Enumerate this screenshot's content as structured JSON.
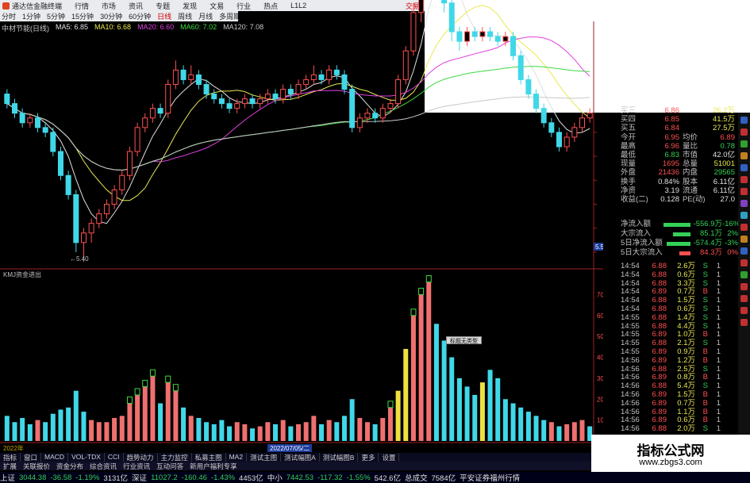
{
  "menu": [
    "通达信金融终端",
    "行情",
    "市场",
    "资讯",
    "专题",
    "发现",
    "文易",
    "行业",
    "热点",
    "L1L2"
  ],
  "trade_label": "交易",
  "periods": [
    "分时",
    "1分钟",
    "5分钟",
    "15分钟",
    "30分钟",
    "60分钟",
    "日线",
    "周线",
    "月线",
    "多周期",
    "更多"
  ],
  "active_period": "日线",
  "ma_legend": [
    {
      "text": "中材节能(日线)",
      "color": "#c8c8c8"
    },
    {
      "text": "MA5: 6.85",
      "color": "#e0e0e0"
    },
    {
      "text": "MA10: 6.68",
      "color": "#e8e850"
    },
    {
      "text": "MA20: 6.60",
      "color": "#e040e0"
    },
    {
      "text": "MA60: 7.02",
      "color": "#40d840"
    },
    {
      "text": "MA120: 7.08",
      "color": "#c8c8c8"
    }
  ],
  "price_axis": [
    "7.75",
    "7.50",
    "7.25",
    "7.00",
    "6.75",
    "6.50",
    "6.25",
    "6.00",
    "5.75",
    "5.50"
  ],
  "current_price_tag": "5.54",
  "low_marker": "5.40",
  "indicator_title": "KMJ资金进出",
  "vol_axis": [
    "70000",
    "60000",
    "50000",
    "40000",
    "30000",
    "20000",
    "10000"
  ],
  "x_label_year": "2022年",
  "x_label_date": "2022/07/05/二",
  "tooltip": "标题无类型",
  "quote": [
    {
      "l1": "买三",
      "v1": "6.86",
      "v1c": "red",
      "l2": "",
      "v2": "26.2万",
      "v2c": "yellow"
    },
    {
      "l1": "买四",
      "v1": "6.85",
      "v1c": "red",
      "l2": "",
      "v2": "41.5万",
      "v2c": "yellow"
    },
    {
      "l1": "买五",
      "v1": "6.84",
      "v1c": "red",
      "l2": "",
      "v2": "27.5万",
      "v2c": "yellow"
    },
    {
      "l1": "今开",
      "v1": "6.95",
      "v1c": "red",
      "l2": "均价",
      "v2": "6.89",
      "v2c": "red"
    },
    {
      "l1": "最高",
      "v1": "6.96",
      "v1c": "red",
      "l2": "量比",
      "v2": "0.78",
      "v2c": "green"
    },
    {
      "l1": "最低",
      "v1": "6.83",
      "v1c": "green",
      "l2": "市值",
      "v2": "42.0亿",
      "v2c": "white"
    },
    {
      "l1": "现量",
      "v1": "1695",
      "v1c": "red",
      "l2": "总量",
      "v2": "51001",
      "v2c": "yellow"
    },
    {
      "l1": "外盘",
      "v1": "21436",
      "v1c": "red",
      "l2": "内盘",
      "v2": "29565",
      "v2c": "green"
    },
    {
      "l1": "换手",
      "v1": "0.84%",
      "v1c": "white",
      "l2": "股本",
      "v2": "6.11亿",
      "v2c": "white"
    },
    {
      "l1": "净资",
      "v1": "3.19",
      "v1c": "white",
      "l2": "流通",
      "v2": "6.11亿",
      "v2c": "white"
    },
    {
      "l1": "收益(二)",
      "v1": "0.128",
      "v1c": "white",
      "l2": "PE(动)",
      "v2": "27.0",
      "v2c": "white"
    }
  ],
  "fund_flow": [
    {
      "name": "净流入额",
      "bar": 34,
      "bar_color": "#34d058",
      "value": "-556.9万",
      "value_color": "green",
      "pct": "-16%",
      "pct_color": "green"
    },
    {
      "name": "大宗流入",
      "bar": 22,
      "bar_color": "#34d058",
      "value": "85.1万",
      "value_color": "green",
      "pct": "2%",
      "pct_color": "green"
    },
    {
      "name": "5日净流入额",
      "bar": 30,
      "bar_color": "#34d058",
      "value": "-574.4万",
      "value_color": "green",
      "pct": "-3%",
      "pct_color": "green"
    },
    {
      "name": "5日大宗流入",
      "bar": 14,
      "bar_color": "#ff5050",
      "value": "84.3万",
      "value_color": "red",
      "pct": "0%",
      "pct_color": "red"
    }
  ],
  "ticks": [
    {
      "t": "14:54",
      "p": "6.88",
      "v": "2.6万",
      "bs": "S",
      "n": "1"
    },
    {
      "t": "14:54",
      "p": "6.88",
      "v": "0.6万",
      "bs": "S",
      "n": "1"
    },
    {
      "t": "14:54",
      "p": "6.88",
      "v": "3.3万",
      "bs": "S",
      "n": "1"
    },
    {
      "t": "14:54",
      "p": "6.89",
      "v": "0.7万",
      "bs": "B",
      "n": "1"
    },
    {
      "t": "14:54",
      "p": "6.88",
      "v": "1.5万",
      "bs": "S",
      "n": "1"
    },
    {
      "t": "14:54",
      "p": "6.88",
      "v": "0.6万",
      "bs": "S",
      "n": "1"
    },
    {
      "t": "14:55",
      "p": "6.88",
      "v": "1.4万",
      "bs": "S",
      "n": "1"
    },
    {
      "t": "14:55",
      "p": "6.88",
      "v": "4.4万",
      "bs": "S",
      "n": "1"
    },
    {
      "t": "14:55",
      "p": "6.89",
      "v": "1.0万",
      "bs": "B",
      "n": "1"
    },
    {
      "t": "14:55",
      "p": "6.88",
      "v": "2.1万",
      "bs": "S",
      "n": "1"
    },
    {
      "t": "14:55",
      "p": "6.89",
      "v": "0.9万",
      "bs": "B",
      "n": "1"
    },
    {
      "t": "14:56",
      "p": "6.89",
      "v": "1.2万",
      "bs": "B",
      "n": "1"
    },
    {
      "t": "14:56",
      "p": "6.88",
      "v": "2.5万",
      "bs": "S",
      "n": "1"
    },
    {
      "t": "14:56",
      "p": "6.89",
      "v": "0.8万",
      "bs": "B",
      "n": "1"
    },
    {
      "t": "14:56",
      "p": "6.88",
      "v": "5.4万",
      "bs": "S",
      "n": "1"
    },
    {
      "t": "14:56",
      "p": "6.89",
      "v": "1.5万",
      "bs": "B",
      "n": "1"
    },
    {
      "t": "14:56",
      "p": "6.89",
      "v": "0.7万",
      "bs": "B",
      "n": "1"
    },
    {
      "t": "14:56",
      "p": "6.89",
      "v": "1.1万",
      "bs": "B",
      "n": "1"
    },
    {
      "t": "14:56",
      "p": "6.89",
      "v": "0.6万",
      "bs": "B",
      "n": "1"
    },
    {
      "t": "14:56",
      "p": "6.88",
      "v": "2.0万",
      "bs": "S",
      "n": "1"
    }
  ],
  "func_tabs": [
    "指标",
    "窗口",
    "MACD",
    "VOL-TDX",
    "CCI",
    "趋势动力",
    "主力监控",
    "私募主图",
    "MA2",
    "测试主图",
    "测试幅图A",
    "测试幅图B",
    "更多",
    "设置"
  ],
  "func_tabs2": [
    "扩展",
    "关联报价",
    "资金分布",
    "综合资讯",
    "行业资讯",
    "互动问答",
    "新用户福利专享"
  ],
  "status": [
    {
      "text": "上证",
      "c": "white"
    },
    {
      "text": "3044.38",
      "c": "green"
    },
    {
      "text": "-36.58",
      "c": "green"
    },
    {
      "text": "-1.19%",
      "c": "green"
    },
    {
      "text": "3131亿",
      "c": "white"
    },
    {
      "text": "深证",
      "c": "white"
    },
    {
      "text": "11027.2",
      "c": "green"
    },
    {
      "text": "-160.46",
      "c": "green"
    },
    {
      "text": "-1.43%",
      "c": "green"
    },
    {
      "text": "4453亿",
      "c": "white"
    },
    {
      "text": "中小",
      "c": "white"
    },
    {
      "text": "7442.53",
      "c": "green"
    },
    {
      "text": "-117.32",
      "c": "green"
    },
    {
      "text": "-1.55%",
      "c": "green"
    },
    {
      "text": "542.6亿",
      "c": "white"
    },
    {
      "text": "总成交",
      "c": "white"
    },
    {
      "text": "7584亿",
      "c": "white"
    },
    {
      "text": "平安证券福州行情",
      "c": "white"
    }
  ],
  "watermark": {
    "title": "指标公式网",
    "url": "www.zbgs3.com"
  },
  "colors": {
    "up": "#ff5050",
    "down": "#40d8e8",
    "ma5": "#e0e0e0",
    "ma10": "#e8e850",
    "ma20": "#e040e0",
    "ma60": "#40d840",
    "ma120": "#c8c8c8",
    "axis": "#a02020"
  },
  "chart_data": {
    "type": "candlestick+bar",
    "price_ylim": [
      5.4,
      7.8
    ],
    "candles": [
      [
        7.15,
        7.05,
        7.2,
        7.0
      ],
      [
        7.05,
        6.95,
        7.1,
        6.9
      ],
      [
        6.95,
        6.85,
        7.0,
        6.8
      ],
      [
        6.85,
        6.9,
        6.95,
        6.8
      ],
      [
        6.9,
        6.8,
        6.95,
        6.75
      ],
      [
        6.8,
        6.75,
        6.85,
        6.7
      ],
      [
        6.75,
        6.55,
        6.8,
        6.5
      ],
      [
        6.55,
        6.3,
        6.6,
        6.25
      ],
      [
        6.3,
        6.1,
        6.35,
        6.05
      ],
      [
        6.1,
        5.6,
        6.15,
        5.5
      ],
      [
        5.6,
        5.7,
        5.75,
        5.4
      ],
      [
        5.7,
        5.8,
        5.85,
        5.6
      ],
      [
        5.8,
        5.9,
        5.95,
        5.75
      ],
      [
        5.9,
        6.0,
        6.05,
        5.85
      ],
      [
        6.0,
        6.15,
        6.2,
        5.95
      ],
      [
        6.15,
        6.3,
        6.35,
        6.1
      ],
      [
        6.3,
        6.55,
        6.6,
        6.25
      ],
      [
        6.55,
        6.8,
        6.85,
        6.5
      ],
      [
        6.8,
        6.9,
        6.95,
        6.75
      ],
      [
        6.9,
        7.0,
        7.05,
        6.85
      ],
      [
        7.0,
        6.95,
        7.05,
        6.9
      ],
      [
        6.95,
        7.25,
        7.3,
        6.9
      ],
      [
        7.25,
        7.4,
        7.5,
        7.2
      ],
      [
        7.4,
        7.3,
        7.45,
        7.25
      ],
      [
        7.3,
        7.35,
        7.45,
        7.25
      ],
      [
        7.35,
        7.25,
        7.4,
        7.2
      ],
      [
        7.25,
        7.15,
        7.3,
        7.1
      ],
      [
        7.15,
        7.1,
        7.2,
        7.05
      ],
      [
        7.1,
        7.05,
        7.15,
        7.0
      ],
      [
        7.05,
        7.0,
        7.1,
        6.95
      ],
      [
        7.0,
        7.05,
        7.1,
        6.95
      ],
      [
        7.05,
        7.1,
        7.15,
        7.0
      ],
      [
        7.1,
        7.05,
        7.15,
        7.0
      ],
      [
        7.05,
        7.1,
        7.15,
        7.0
      ],
      [
        7.1,
        7.15,
        7.2,
        7.05
      ],
      [
        7.15,
        7.1,
        7.2,
        7.05
      ],
      [
        7.1,
        7.2,
        7.25,
        7.05
      ],
      [
        7.2,
        7.15,
        7.25,
        7.1
      ],
      [
        7.15,
        7.25,
        7.3,
        7.1
      ],
      [
        7.25,
        7.3,
        7.35,
        7.2
      ],
      [
        7.3,
        7.35,
        7.45,
        7.25
      ],
      [
        7.35,
        7.3,
        7.4,
        7.25
      ],
      [
        7.3,
        7.4,
        7.45,
        7.25
      ],
      [
        7.4,
        7.35,
        7.45,
        7.3
      ],
      [
        7.35,
        7.2,
        7.4,
        7.15
      ],
      [
        7.2,
        6.8,
        7.25,
        6.75
      ],
      [
        6.8,
        6.9,
        6.95,
        6.75
      ],
      [
        6.9,
        6.95,
        7.0,
        6.85
      ],
      [
        6.95,
        6.9,
        7.0,
        6.85
      ],
      [
        6.9,
        7.0,
        7.05,
        6.85
      ],
      [
        7.0,
        7.05,
        7.1,
        6.95
      ],
      [
        7.05,
        7.3,
        7.35,
        7.0
      ],
      [
        7.3,
        7.6,
        7.65,
        7.25
      ],
      [
        7.6,
        8.0,
        8.1,
        7.55
      ],
      [
        8.0,
        8.4,
        8.6,
        7.9
      ],
      [
        8.4,
        8.9,
        9.3,
        8.3
      ],
      [
        8.9,
        8.5,
        9.0,
        8.4
      ],
      [
        8.5,
        8.1,
        8.6,
        8.0
      ],
      [
        8.1,
        7.8,
        8.2,
        7.7
      ],
      [
        7.8,
        7.7,
        7.85,
        7.6
      ],
      [
        7.7,
        7.8,
        7.85,
        7.65
      ],
      [
        7.8,
        7.75,
        7.85,
        7.7
      ],
      [
        7.75,
        7.8,
        7.85,
        7.7
      ],
      [
        7.8,
        7.75,
        7.85,
        7.7
      ],
      [
        7.75,
        7.7,
        7.8,
        7.65
      ],
      [
        7.7,
        7.75,
        7.8,
        7.65
      ],
      [
        7.75,
        7.55,
        7.8,
        7.5
      ],
      [
        7.55,
        7.3,
        7.6,
        7.25
      ],
      [
        7.3,
        7.15,
        7.35,
        7.1
      ],
      [
        7.15,
        7.0,
        7.2,
        6.95
      ],
      [
        7.0,
        6.85,
        7.05,
        6.8
      ],
      [
        6.85,
        6.75,
        6.9,
        6.7
      ],
      [
        6.75,
        6.6,
        6.8,
        6.55
      ],
      [
        6.6,
        6.7,
        6.75,
        6.55
      ],
      [
        6.7,
        6.8,
        6.85,
        6.65
      ],
      [
        6.8,
        6.9,
        6.95,
        6.75
      ],
      [
        6.9,
        6.95,
        7.0,
        6.85
      ]
    ],
    "vol_ylim": [
      0,
      80000
    ],
    "volumes": [
      [
        12000,
        "c"
      ],
      [
        9000,
        "c"
      ],
      [
        11000,
        "c"
      ],
      [
        8000,
        "c"
      ],
      [
        10000,
        "r"
      ],
      [
        9000,
        "c"
      ],
      [
        13000,
        "c"
      ],
      [
        15000,
        "c"
      ],
      [
        16000,
        "c"
      ],
      [
        24000,
        "c"
      ],
      [
        14000,
        "c"
      ],
      [
        10000,
        "r"
      ],
      [
        9000,
        "r"
      ],
      [
        9000,
        "r"
      ],
      [
        11000,
        "r"
      ],
      [
        12000,
        "r"
      ],
      [
        18000,
        "r"
      ],
      [
        22000,
        "r"
      ],
      [
        26000,
        "r"
      ],
      [
        31000,
        "r"
      ],
      [
        18000,
        "c"
      ],
      [
        28000,
        "r"
      ],
      [
        24000,
        "r"
      ],
      [
        16000,
        "c"
      ],
      [
        12000,
        "r"
      ],
      [
        11000,
        "c"
      ],
      [
        9000,
        "c"
      ],
      [
        8000,
        "c"
      ],
      [
        10000,
        "c"
      ],
      [
        7000,
        "c"
      ],
      [
        9000,
        "r"
      ],
      [
        8000,
        "r"
      ],
      [
        6000,
        "c"
      ],
      [
        7000,
        "r"
      ],
      [
        9000,
        "r"
      ],
      [
        8000,
        "c"
      ],
      [
        10000,
        "r"
      ],
      [
        7000,
        "c"
      ],
      [
        8000,
        "r"
      ],
      [
        9000,
        "r"
      ],
      [
        12000,
        "r"
      ],
      [
        8000,
        "c"
      ],
      [
        10000,
        "r"
      ],
      [
        9000,
        "c"
      ],
      [
        12000,
        "c"
      ],
      [
        20000,
        "c"
      ],
      [
        11000,
        "r"
      ],
      [
        9000,
        "r"
      ],
      [
        8000,
        "c"
      ],
      [
        11000,
        "r"
      ],
      [
        16000,
        "r"
      ],
      [
        24000,
        "y"
      ],
      [
        44000,
        "y"
      ],
      [
        60000,
        "r"
      ],
      [
        70000,
        "r"
      ],
      [
        76000,
        "r"
      ],
      [
        56000,
        "c"
      ],
      [
        48000,
        "c"
      ],
      [
        40000,
        "c"
      ],
      [
        30000,
        "c"
      ],
      [
        26000,
        "c"
      ],
      [
        22000,
        "c"
      ],
      [
        28000,
        "y"
      ],
      [
        34000,
        "c"
      ],
      [
        30000,
        "c"
      ],
      [
        20000,
        "c"
      ],
      [
        18000,
        "c"
      ],
      [
        16000,
        "c"
      ],
      [
        14000,
        "c"
      ],
      [
        12000,
        "c"
      ],
      [
        10000,
        "c"
      ],
      [
        9000,
        "r"
      ],
      [
        7000,
        "c"
      ],
      [
        8000,
        "r"
      ],
      [
        9000,
        "r"
      ],
      [
        10000,
        "r"
      ],
      [
        7000,
        "c"
      ]
    ]
  }
}
